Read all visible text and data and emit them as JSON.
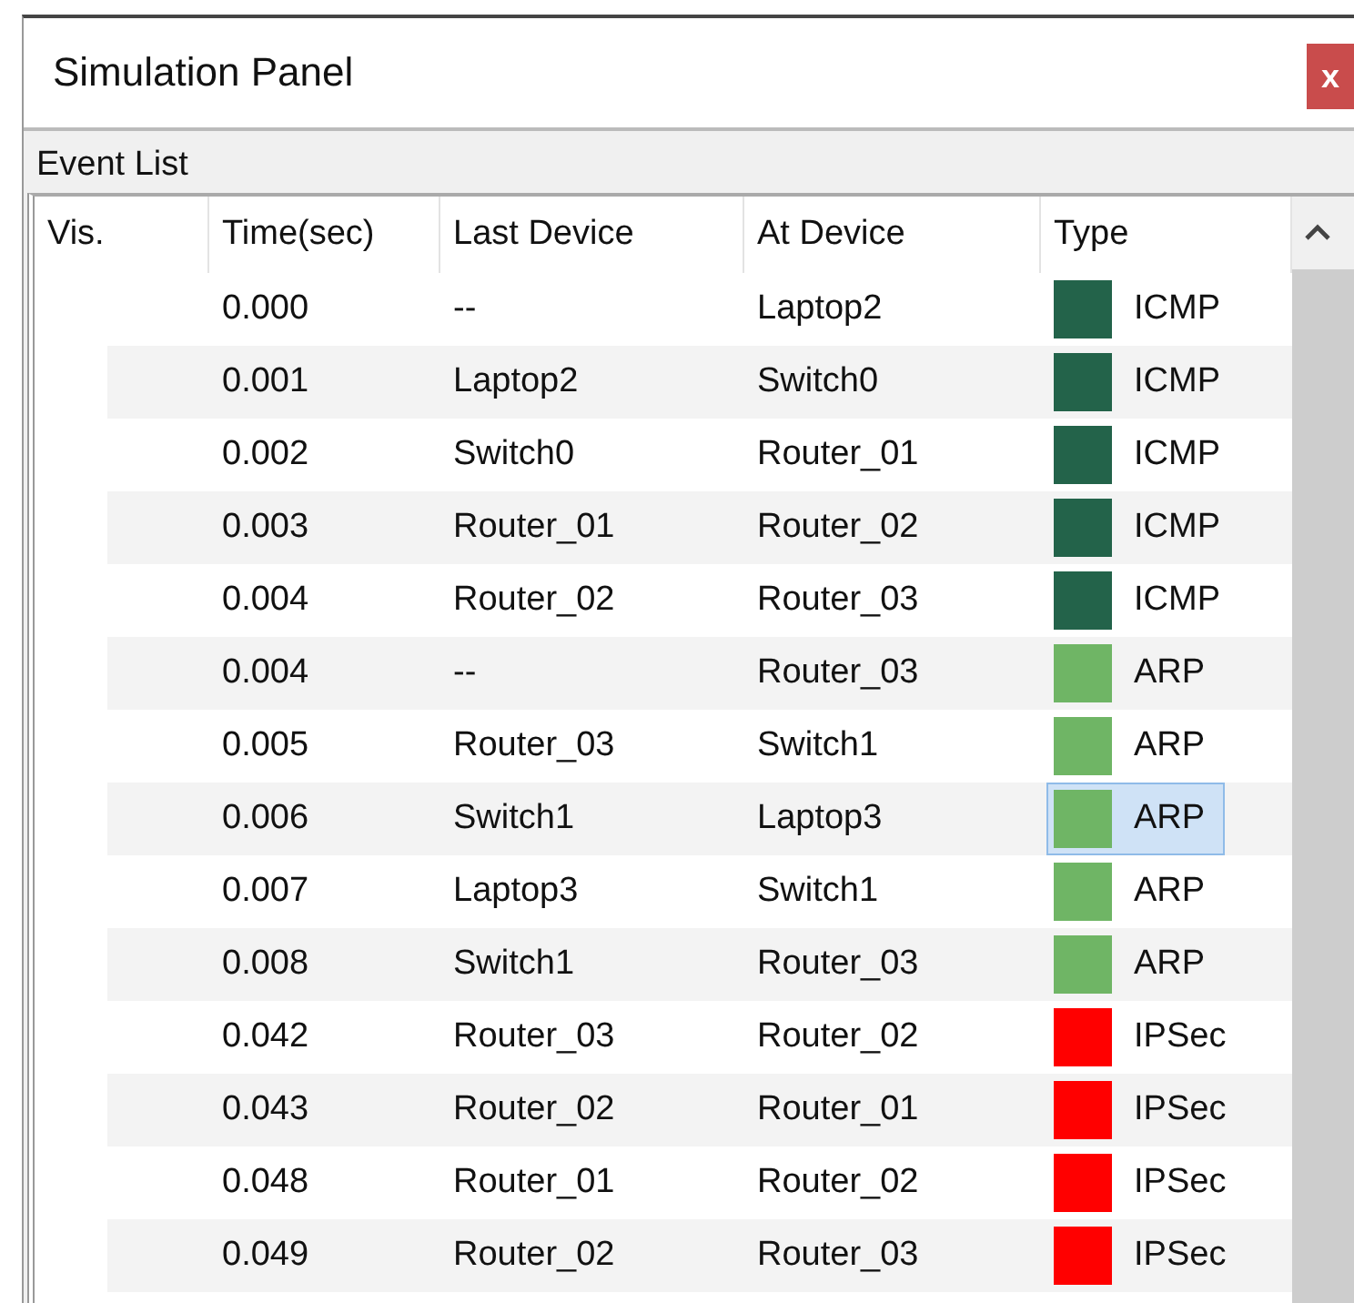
{
  "window": {
    "title": "Simulation Panel",
    "close": "x"
  },
  "event_list": {
    "title": "Event List",
    "columns": [
      "Vis.",
      "Time(sec)",
      "Last Device",
      "At Device",
      "Type"
    ],
    "rows": [
      {
        "time": "0.000",
        "last_device": "--",
        "at_device": "Laptop2",
        "type": "ICMP",
        "color": "#23634a",
        "selected": false
      },
      {
        "time": "0.001",
        "last_device": "Laptop2",
        "at_device": "Switch0",
        "type": "ICMP",
        "color": "#23634a",
        "selected": false
      },
      {
        "time": "0.002",
        "last_device": "Switch0",
        "at_device": "Router_01",
        "type": "ICMP",
        "color": "#23634a",
        "selected": false
      },
      {
        "time": "0.003",
        "last_device": "Router_01",
        "at_device": "Router_02",
        "type": "ICMP",
        "color": "#23634a",
        "selected": false
      },
      {
        "time": "0.004",
        "last_device": "Router_02",
        "at_device": "Router_03",
        "type": "ICMP",
        "color": "#23634a",
        "selected": false
      },
      {
        "time": "0.004",
        "last_device": "--",
        "at_device": "Router_03",
        "type": "ARP",
        "color": "#6fb565",
        "selected": false
      },
      {
        "time": "0.005",
        "last_device": "Router_03",
        "at_device": "Switch1",
        "type": "ARP",
        "color": "#6fb565",
        "selected": false
      },
      {
        "time": "0.006",
        "last_device": "Switch1",
        "at_device": "Laptop3",
        "type": "ARP",
        "color": "#6fb565",
        "selected": true
      },
      {
        "time": "0.007",
        "last_device": "Laptop3",
        "at_device": "Switch1",
        "type": "ARP",
        "color": "#6fb565",
        "selected": false
      },
      {
        "time": "0.008",
        "last_device": "Switch1",
        "at_device": "Router_03",
        "type": "ARP",
        "color": "#6fb565",
        "selected": false
      },
      {
        "time": "0.042",
        "last_device": "Router_03",
        "at_device": "Router_02",
        "type": "IPSec",
        "color": "#ff0000",
        "selected": false
      },
      {
        "time": "0.043",
        "last_device": "Router_02",
        "at_device": "Router_01",
        "type": "IPSec",
        "color": "#ff0000",
        "selected": false
      },
      {
        "time": "0.048",
        "last_device": "Router_01",
        "at_device": "Router_02",
        "type": "IPSec",
        "color": "#ff0000",
        "selected": false
      },
      {
        "time": "0.049",
        "last_device": "Router_02",
        "at_device": "Router_03",
        "type": "IPSec",
        "color": "#ff0000",
        "selected": false
      }
    ]
  }
}
